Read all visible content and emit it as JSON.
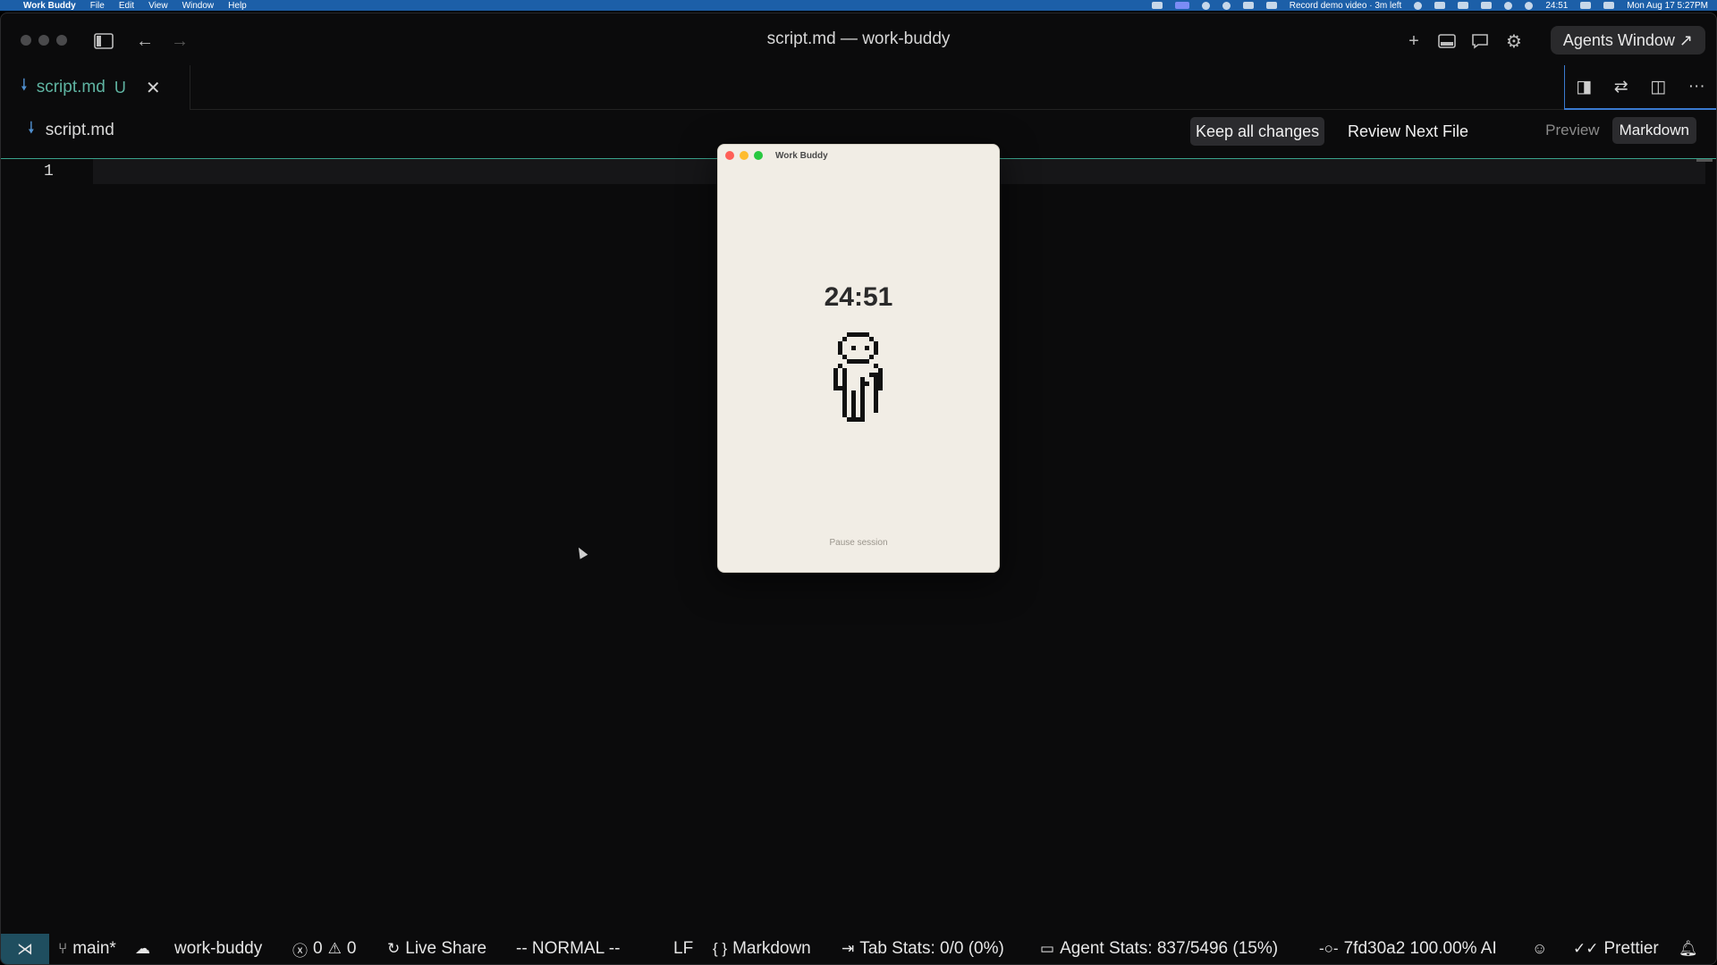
{
  "menubar": {
    "app_name": "Work Buddy",
    "menus": [
      "File",
      "Edit",
      "View",
      "Window",
      "Help"
    ],
    "record_text": "Record demo video · 3m left",
    "timer": "24:51",
    "datetime": "Mon Aug 17  5:27PM"
  },
  "window": {
    "title": "script.md — work-buddy",
    "agents_button": "Agents Window ↗"
  },
  "tab": {
    "name": "script.md",
    "status": "U"
  },
  "breadcrumb": {
    "file": "script.md"
  },
  "diff": {
    "keep_label": "Keep all changes",
    "review_label": "Review Next File",
    "preview_label": "Preview",
    "markdown_label": "Markdown"
  },
  "editor": {
    "line_number": "1"
  },
  "statusbar": {
    "branch": "main*",
    "workspace": "work-buddy",
    "errors": "0",
    "warnings": "0",
    "live_share": "Live Share",
    "vim_mode": "-- NORMAL --",
    "eol": "LF",
    "language": "Markdown",
    "tab_stats": "Tab Stats: 0/0 (0%)",
    "agent_stats": "Agent Stats: 837/5496 (15%)",
    "commit": "7fd30a2 100.00% AI",
    "prettier": "Prettier"
  },
  "buddy": {
    "title": "Work Buddy",
    "timer": "24:51",
    "pause_label": "Pause session"
  },
  "colors": {
    "accent_teal": "#5fb4a2",
    "accent_blue": "#3a7ad0",
    "buddy_bg": "#f1ede5",
    "close_red": "#ff5f57",
    "min_yellow": "#febc2e",
    "max_green": "#28c840"
  }
}
